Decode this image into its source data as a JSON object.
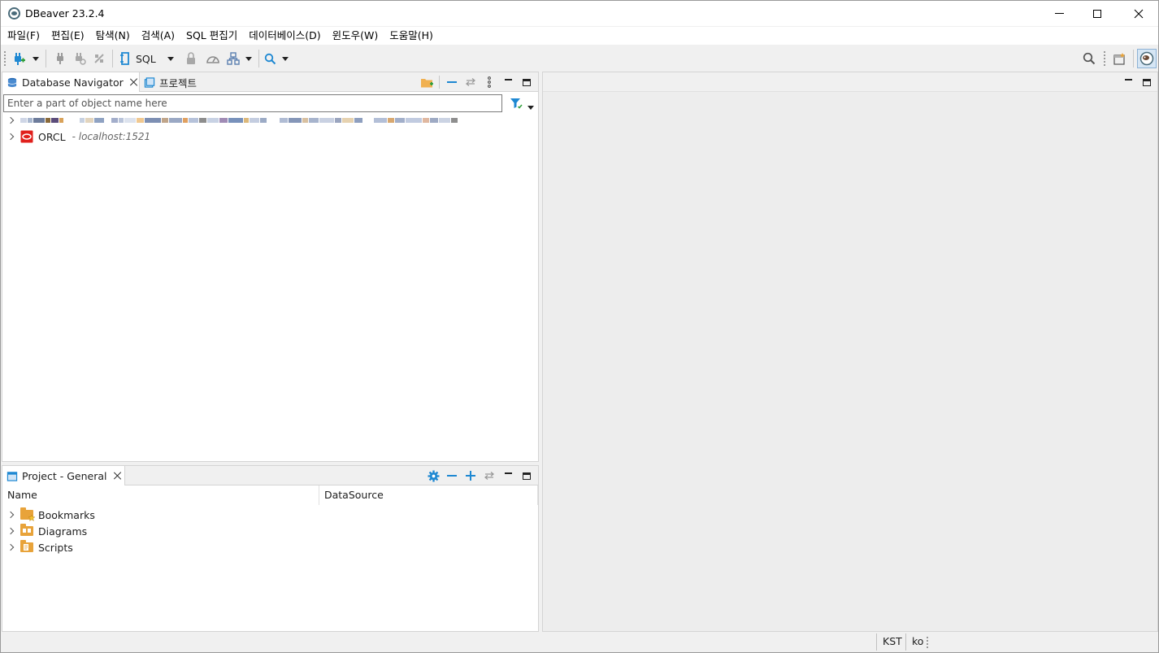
{
  "window": {
    "title": "DBeaver 23.2.4"
  },
  "menu": [
    "파일(F)",
    "편집(E)",
    "탐색(N)",
    "검색(A)",
    "SQL 편집기",
    "데이터베이스(D)",
    "윈도우(W)",
    "도움말(H)"
  ],
  "toolbar": {
    "sql_label": "SQL"
  },
  "navigator": {
    "tab_label": "Database Navigator",
    "projects_tab_label": "프로젝트",
    "filter_placeholder": "Enter a part of object name here",
    "connections": [
      {
        "name": "ORCL",
        "host": "- localhost:1521"
      }
    ]
  },
  "project": {
    "tab_label": "Project - General",
    "columns": [
      "Name",
      "DataSource"
    ],
    "items": [
      "Bookmarks",
      "Diagrams",
      "Scripts"
    ]
  },
  "status": {
    "timezone": "KST",
    "locale": "ko"
  },
  "colors": {
    "accent": "#1e88d2",
    "oracle": "#e0201c",
    "folder": "#e8a33a"
  }
}
